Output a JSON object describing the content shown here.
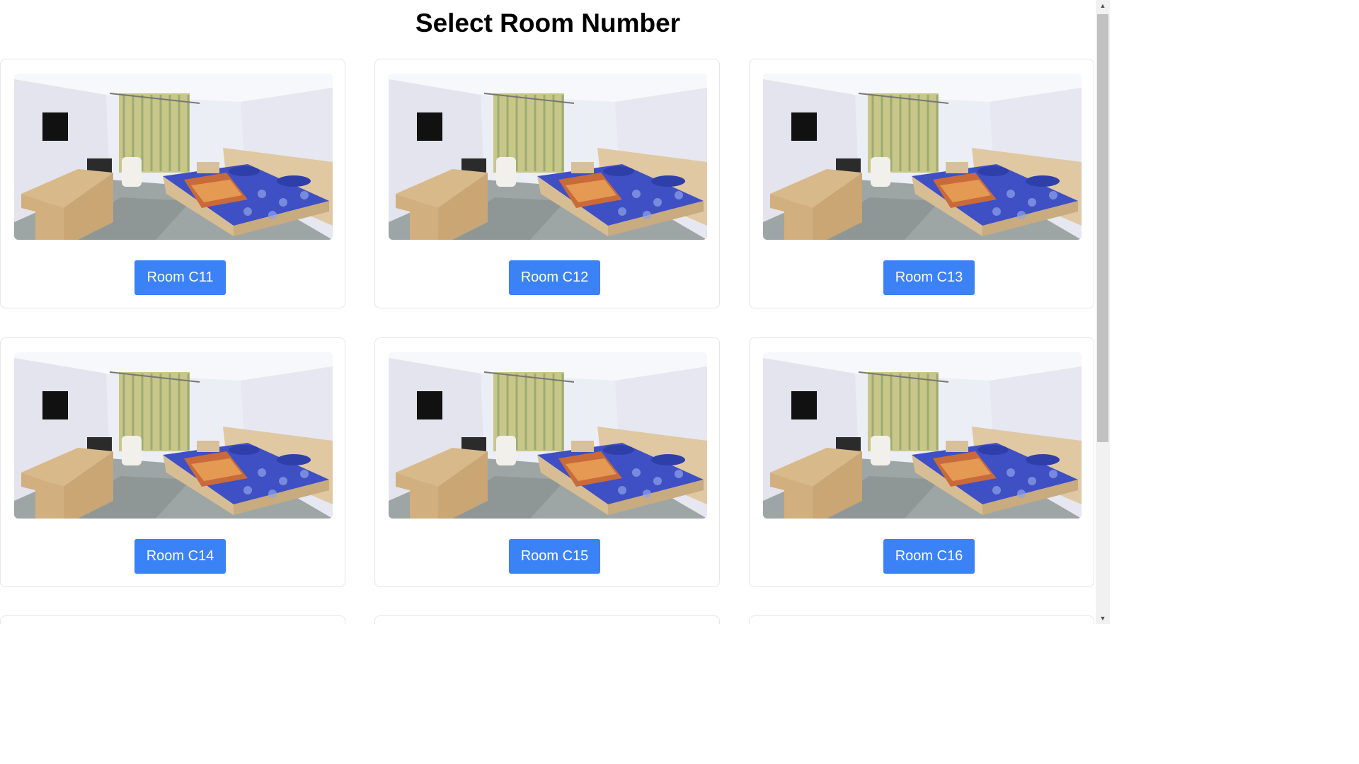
{
  "page": {
    "title": "Select Room Number"
  },
  "rooms": [
    {
      "label": "Room C11",
      "photo": "hotel-room-photo"
    },
    {
      "label": "Room C12",
      "photo": "hotel-room-photo"
    },
    {
      "label": "Room C13",
      "photo": "hotel-room-photo"
    },
    {
      "label": "Room C14",
      "photo": "hotel-room-photo"
    },
    {
      "label": "Room C15",
      "photo": "hotel-room-photo"
    },
    {
      "label": "Room C16",
      "photo": "hotel-room-photo"
    }
  ],
  "colors": {
    "button": "#3b82f6",
    "button_text": "#ffffff",
    "card_border": "#e6e6e6"
  },
  "scrollbar": {
    "up_icon": "scroll-up-arrow-icon",
    "down_icon": "scroll-down-arrow-icon"
  }
}
